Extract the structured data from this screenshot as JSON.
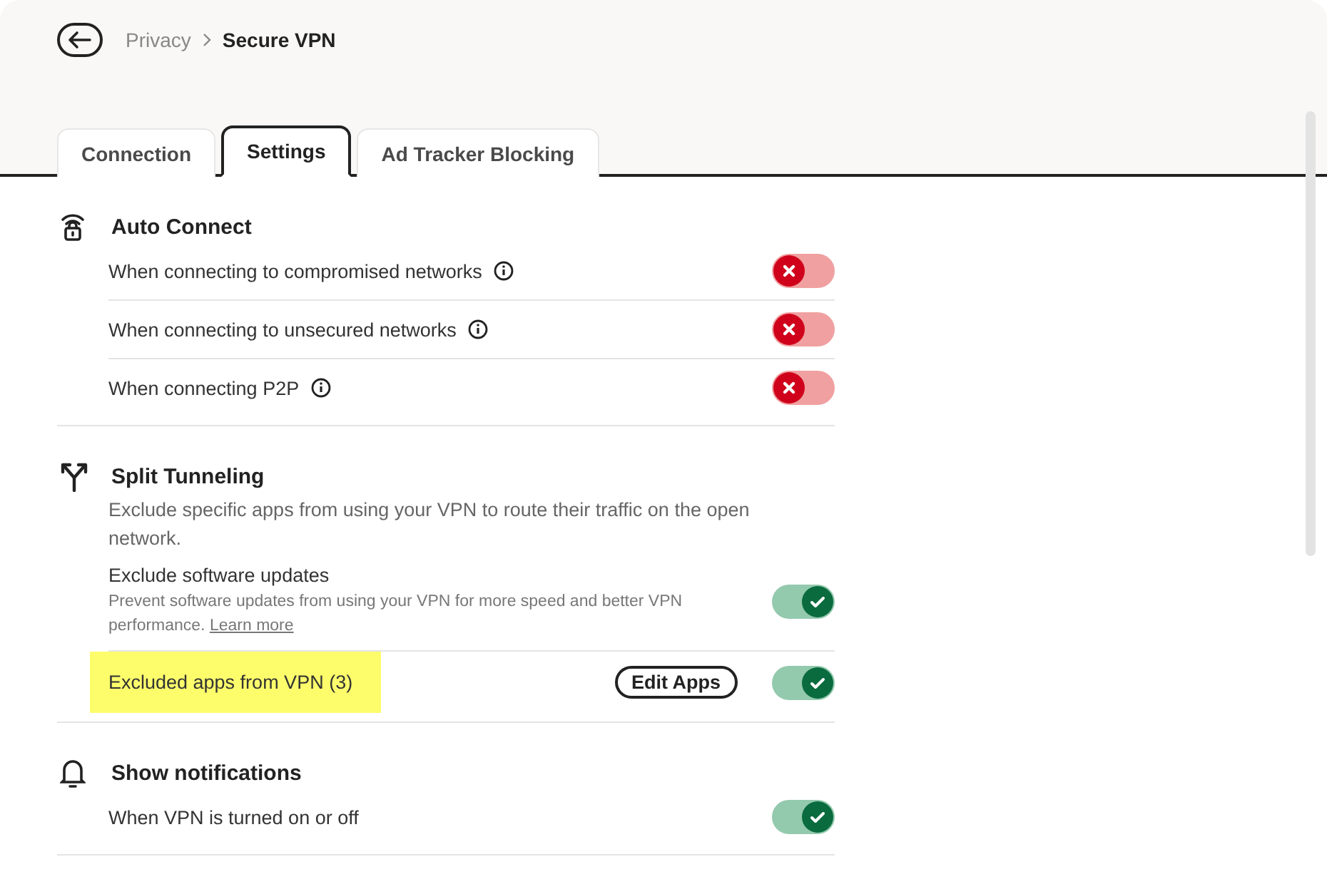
{
  "breadcrumb": {
    "parent": "Privacy",
    "current": "Secure VPN"
  },
  "tabs": [
    {
      "label": "Connection",
      "selected": false
    },
    {
      "label": "Settings",
      "selected": true
    },
    {
      "label": "Ad Tracker Blocking",
      "selected": false
    }
  ],
  "sections": [
    {
      "kind": "wifi-lock",
      "title": "Auto Connect",
      "rows": [
        {
          "label": "When connecting to compromised networks",
          "info": true,
          "on": false
        },
        {
          "label": "When connecting to unsecured networks",
          "info": true,
          "on": false
        },
        {
          "label": "When connecting P2P",
          "info": true,
          "on": false
        }
      ]
    },
    {
      "kind": "split",
      "title": "Split Tunneling",
      "description": "Exclude specific apps from using your VPN to route their traffic on the open network.",
      "rows": [
        {
          "label": "Exclude software updates",
          "note": "Prevent software updates from using your VPN for more speed and better VPN performance.",
          "link": "Learn more",
          "on": true
        },
        {
          "label": "Excluded apps from VPN (3)",
          "button": "Edit Apps",
          "highlighted": true,
          "on": true
        }
      ]
    },
    {
      "kind": "bell",
      "title": "Show notifications",
      "rows": [
        {
          "label": "When VPN is turned on or off",
          "on": true
        }
      ]
    }
  ]
}
